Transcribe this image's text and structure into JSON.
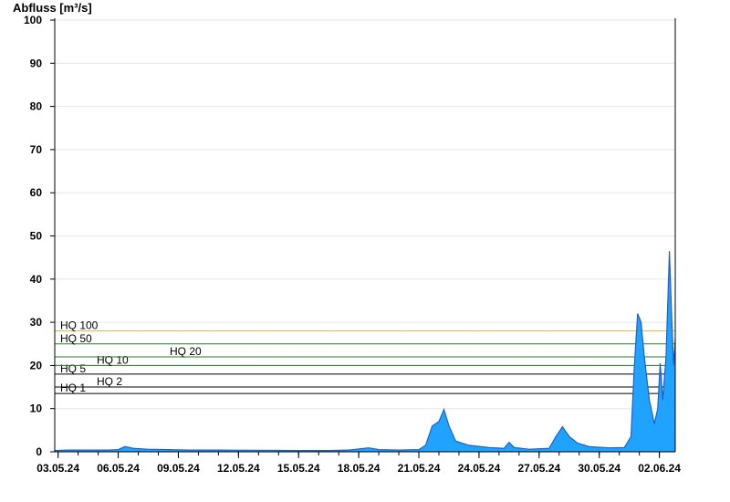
{
  "chart_data": {
    "type": "area",
    "ylabel": "Abfluss [m³/s]",
    "ylim": [
      0,
      100
    ],
    "yticks": [
      0,
      10,
      20,
      30,
      40,
      50,
      60,
      70,
      80,
      90,
      100
    ],
    "xlim": [
      "2024-05-02T20:00",
      "2024-06-02T19:00"
    ],
    "xticks": [
      {
        "date": "2024-05-03",
        "label": "03.05.24"
      },
      {
        "date": "2024-05-06",
        "label": "06.05.24"
      },
      {
        "date": "2024-05-09",
        "label": "09.05.24"
      },
      {
        "date": "2024-05-12",
        "label": "12.05.24"
      },
      {
        "date": "2024-05-15",
        "label": "15.05.24"
      },
      {
        "date": "2024-05-18",
        "label": "18.05.24"
      },
      {
        "date": "2024-05-21",
        "label": "21.05.24"
      },
      {
        "date": "2024-05-24",
        "label": "24.05.24"
      },
      {
        "date": "2024-05-27",
        "label": "27.05.24"
      },
      {
        "date": "2024-05-30",
        "label": "30.05.24"
      },
      {
        "date": "2024-06-02",
        "label": "02.06.24"
      }
    ],
    "grid": true,
    "series_color": "#1fa3ff",
    "series_line_color": "#1d5fd1",
    "thresholds": [
      {
        "label": "HQ 1",
        "value": 13.5,
        "color": "#000000"
      },
      {
        "label": "HQ 2",
        "value": 15.0,
        "color": "#000000"
      },
      {
        "label": "HQ 5",
        "value": 18.0,
        "color": "#000000"
      },
      {
        "label": "HQ 10",
        "value": 20.0,
        "color": "#2b7a2b"
      },
      {
        "label": "HQ 20",
        "value": 22.0,
        "color": "#2b7a2b"
      },
      {
        "label": "HQ 50",
        "value": 25.0,
        "color": "#2b7a2b"
      },
      {
        "label": "HQ 100",
        "value": 28.0,
        "color": "#e8b84a"
      }
    ],
    "points": [
      [
        "2024-05-02T20:00",
        0.3
      ],
      [
        "2024-05-03T12:00",
        0.4
      ],
      [
        "2024-05-04T12:00",
        0.4
      ],
      [
        "2024-05-05T12:00",
        0.4
      ],
      [
        "2024-05-06T00:00",
        0.5
      ],
      [
        "2024-05-06T08:00",
        1.2
      ],
      [
        "2024-05-06T18:00",
        0.8
      ],
      [
        "2024-05-07T12:00",
        0.6
      ],
      [
        "2024-05-08T12:00",
        0.5
      ],
      [
        "2024-05-09T12:00",
        0.4
      ],
      [
        "2024-05-11T00:00",
        0.4
      ],
      [
        "2024-05-13T00:00",
        0.35
      ],
      [
        "2024-05-15T00:00",
        0.3
      ],
      [
        "2024-05-16T12:00",
        0.3
      ],
      [
        "2024-05-17T12:00",
        0.4
      ],
      [
        "2024-05-18T12:00",
        0.9
      ],
      [
        "2024-05-19T00:00",
        0.5
      ],
      [
        "2024-05-20T00:00",
        0.4
      ],
      [
        "2024-05-21T00:00",
        0.5
      ],
      [
        "2024-05-21T08:00",
        1.5
      ],
      [
        "2024-05-21T16:00",
        6.0
      ],
      [
        "2024-05-22T00:00",
        7.0
      ],
      [
        "2024-05-22T06:00",
        9.8
      ],
      [
        "2024-05-22T12:00",
        6.0
      ],
      [
        "2024-05-22T20:00",
        2.5
      ],
      [
        "2024-05-23T12:00",
        1.5
      ],
      [
        "2024-05-24T12:00",
        1.0
      ],
      [
        "2024-05-25T06:00",
        0.8
      ],
      [
        "2024-05-25T12:00",
        2.2
      ],
      [
        "2024-05-25T18:00",
        1.0
      ],
      [
        "2024-05-26T12:00",
        0.6
      ],
      [
        "2024-05-27T12:00",
        0.8
      ],
      [
        "2024-05-27T20:00",
        3.5
      ],
      [
        "2024-05-28T04:00",
        5.8
      ],
      [
        "2024-05-28T12:00",
        3.5
      ],
      [
        "2024-05-28T22:00",
        2.0
      ],
      [
        "2024-05-29T12:00",
        1.2
      ],
      [
        "2024-05-30T12:00",
        0.9
      ],
      [
        "2024-05-31T06:00",
        1.0
      ],
      [
        "2024-05-31T14:00",
        3.5
      ],
      [
        "2024-05-31T18:00",
        20.0
      ],
      [
        "2024-05-31T22:00",
        32.0
      ],
      [
        "2024-06-01T02:00",
        30.0
      ],
      [
        "2024-06-01T06:00",
        22.0
      ],
      [
        "2024-06-01T12:00",
        12.0
      ],
      [
        "2024-06-01T18:00",
        6.5
      ],
      [
        "2024-06-01T22:00",
        10.0
      ],
      [
        "2024-06-02T01:00",
        20.5
      ],
      [
        "2024-06-02T04:00",
        12.0
      ],
      [
        "2024-06-02T08:00",
        22.0
      ],
      [
        "2024-06-02T12:00",
        46.5
      ],
      [
        "2024-06-02T15:00",
        30.0
      ],
      [
        "2024-06-02T17:00",
        20.0
      ],
      [
        "2024-06-02T19:00",
        26.0
      ]
    ]
  }
}
